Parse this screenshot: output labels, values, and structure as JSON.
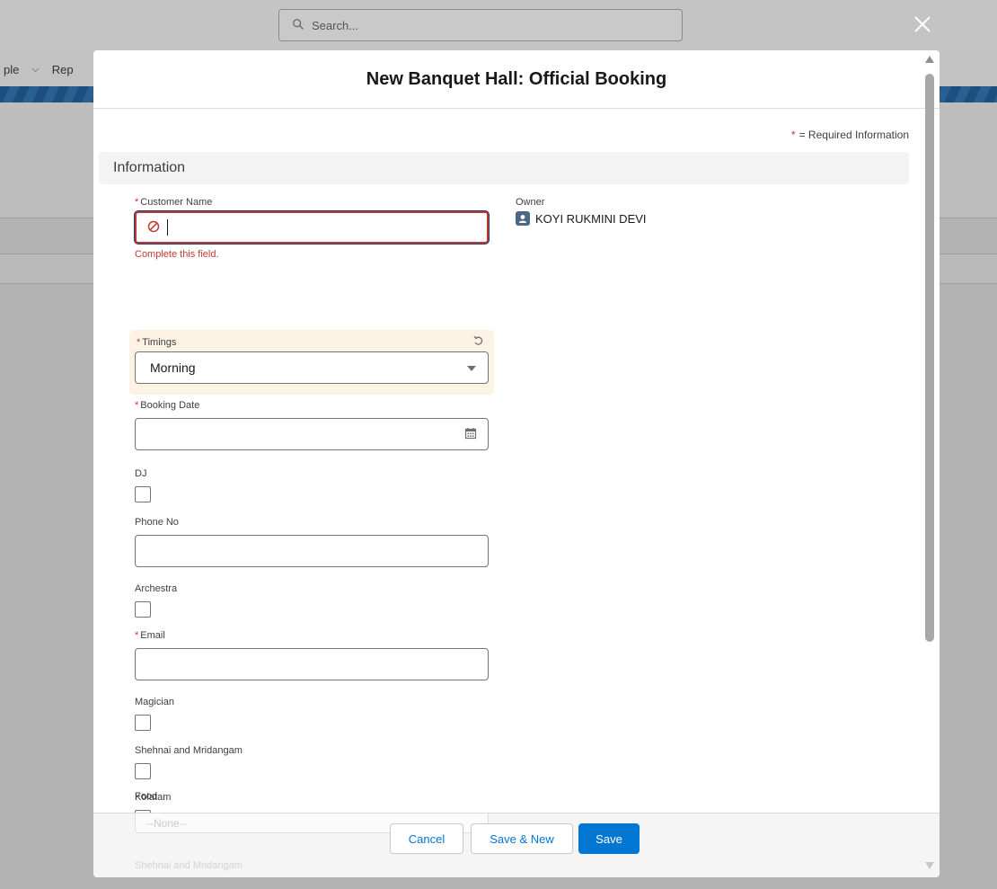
{
  "background": {
    "search_placeholder": "Search...",
    "nav_items": [
      "ple",
      "Rep"
    ]
  },
  "modal": {
    "title": "New Banquet Hall: Official Booking",
    "required_note": "= Required Information",
    "required_marker": "*",
    "section_title": "Information"
  },
  "fields": {
    "customer_name": {
      "label": "Customer Name",
      "value": "",
      "error": "Complete this field."
    },
    "timings": {
      "label": "Timings",
      "value": "Morning"
    },
    "booking_date": {
      "label": "Booking Date",
      "value": ""
    },
    "dj": {
      "label": "DJ",
      "checked": false
    },
    "phone_no": {
      "label": "Phone No",
      "value": ""
    },
    "archestra": {
      "label": "Archestra",
      "checked": false
    },
    "email": {
      "label": "Email",
      "value": ""
    },
    "magician": {
      "label": "Magician",
      "checked": false
    },
    "shehnai": {
      "label": "Shehnai and Mridangam",
      "checked": false
    },
    "kolatam": {
      "label": "Kolatam",
      "checked": false
    },
    "food": {
      "label": "Food",
      "value": "--None--"
    },
    "next_label": "Shehnai and Mridangam"
  },
  "owner": {
    "label": "Owner",
    "name": "KOYI RUKMINI DEVI"
  },
  "footer": {
    "cancel": "Cancel",
    "save_new": "Save & New",
    "save": "Save"
  },
  "colors": {
    "brand": "#0176d3",
    "error": "#c23934",
    "changed_highlight": "#fdf3e4"
  }
}
